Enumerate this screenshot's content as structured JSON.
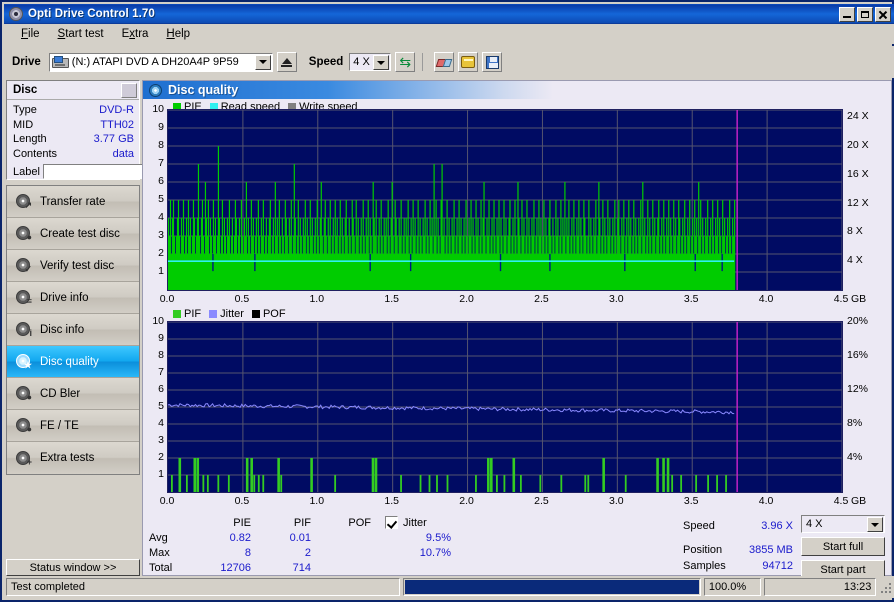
{
  "window": {
    "title": "Opti Drive Control 1.70",
    "icon": "disc-icon",
    "buttons": {
      "minimize": "minimize",
      "maximize": "maximize",
      "close": "close"
    }
  },
  "menu": {
    "items": [
      "File",
      "Start test",
      "Extra",
      "Help"
    ]
  },
  "toolbar": {
    "drive_label": "Drive",
    "drive_value": "(N:)  ATAPI DVD A  DH20A4P 9P59",
    "eject_label": "eject-button",
    "speed_label": "Speed",
    "speed_value": "4 X",
    "icons": [
      "refresh-icon",
      "eraser-icon",
      "bookmark-icon",
      "save-icon"
    ]
  },
  "disc": {
    "header": "Disc",
    "rows": [
      {
        "key": "Type",
        "value": "DVD-R"
      },
      {
        "key": "MID",
        "value": "TTH02"
      },
      {
        "key": "Length",
        "value": "3.77 GB"
      },
      {
        "key": "Contents",
        "value": "data"
      }
    ],
    "label_key": "Label",
    "label_value": ""
  },
  "sidebar": {
    "items": [
      {
        "label": "Transfer rate",
        "active": false
      },
      {
        "label": "Create test disc",
        "active": false
      },
      {
        "label": "Verify test disc",
        "active": false
      },
      {
        "label": "Drive info",
        "active": false
      },
      {
        "label": "Disc info",
        "active": false
      },
      {
        "label": "Disc quality",
        "active": true
      },
      {
        "label": "CD Bler",
        "active": false
      },
      {
        "label": "FE / TE",
        "active": false
      },
      {
        "label": "Extra tests",
        "active": false
      }
    ],
    "status_window": "Status window >>"
  },
  "panel": {
    "title": "Disc quality"
  },
  "stats": {
    "columns": [
      "PIE",
      "PIF",
      "POF"
    ],
    "jitter_label": "Jitter",
    "jitter_checked": true,
    "rows": [
      {
        "label": "Avg",
        "pie": "0.82",
        "pif": "0.01",
        "pof": "",
        "jitter": "9.5%"
      },
      {
        "label": "Max",
        "pie": "8",
        "pif": "2",
        "pof": "",
        "jitter": "10.7%"
      },
      {
        "label": "Total",
        "pie": "12706",
        "pif": "714",
        "pof": "",
        "jitter": ""
      }
    ],
    "speed_key": "Speed",
    "speed_value": "3.96 X",
    "position_key": "Position",
    "position_value": "3855 MB",
    "samples_key": "Samples",
    "samples_value": "94712",
    "speed_select": "4 X",
    "start_full": "Start full",
    "start_part": "Start part"
  },
  "statusbar": {
    "message": "Test completed",
    "progress_text": "100.0%",
    "progress_percent": 100,
    "time": "13:23"
  },
  "colors": {
    "pie": "#00cc00",
    "read_speed": "#2ff0f0",
    "write_speed": "#808080",
    "pif": "#33cc22",
    "jitter": "#8a8aff",
    "pof": "#000000",
    "plot_bg": "#000b63",
    "marker": "#cc22cc",
    "accent": "#1a1acc"
  },
  "chart_data": [
    {
      "type": "bar",
      "title": "Disc quality - PIE",
      "legend": [
        {
          "name": "PIE",
          "color": "#00cc00"
        },
        {
          "name": "Read speed",
          "color": "#2ff0f0"
        },
        {
          "name": "Write speed",
          "color": "#808080"
        }
      ],
      "legend_position": "top-left",
      "xlabel": "GB",
      "ylabel": "PIE",
      "xlim": [
        0,
        4.5
      ],
      "ylim": [
        0,
        10
      ],
      "y2lim": [
        0,
        25
      ],
      "y2label": "X",
      "xticks": [
        "0.0",
        "0.5",
        "1.0",
        "1.5",
        "2.0",
        "2.5",
        "3.0",
        "3.5",
        "4.0",
        "4.5"
      ],
      "yticks": [
        "1",
        "2",
        "3",
        "4",
        "5",
        "6",
        "7",
        "8",
        "9",
        "10"
      ],
      "y2ticks": [
        "4 X",
        "8 X",
        "12 X",
        "16 X",
        "20 X",
        "24 X"
      ],
      "grid": true,
      "data_end_gb": 3.78,
      "marker_gb": 3.8,
      "series": [
        {
          "name": "PIE",
          "type": "bar",
          "color": "#00cc00",
          "baseline": 2,
          "summary": {
            "avg": 0.82,
            "max": 8,
            "total": 12706
          },
          "values": [
            4,
            3,
            5,
            2,
            4,
            5,
            3,
            2,
            3,
            4,
            5,
            3,
            2,
            4,
            3,
            5,
            2,
            3,
            4,
            2,
            5,
            3,
            4,
            2,
            3,
            5,
            4,
            2,
            3,
            4,
            7,
            3,
            2,
            4,
            5,
            3,
            2,
            6,
            4,
            3,
            5,
            2,
            4,
            3,
            2,
            5,
            3,
            4,
            2,
            3,
            8,
            4,
            2,
            3,
            5,
            2,
            4,
            3,
            2,
            4,
            3,
            5,
            2,
            3,
            4,
            2,
            3,
            5,
            4,
            2,
            3,
            4,
            2,
            5,
            3,
            2,
            4,
            3,
            6,
            2,
            4,
            3,
            2,
            5,
            3,
            4,
            2,
            3,
            4,
            2,
            5,
            3,
            2,
            4,
            3,
            5,
            2,
            3,
            4,
            2,
            3,
            4,
            5,
            2,
            3,
            4,
            2,
            6,
            3,
            4,
            2,
            5,
            3,
            2,
            4,
            3,
            2,
            5,
            4,
            3,
            2,
            4,
            3,
            5,
            2,
            3,
            7,
            4,
            2,
            3,
            5,
            2,
            4,
            3,
            2,
            4,
            3,
            5,
            2,
            4,
            3,
            2,
            5,
            3,
            4,
            2,
            3,
            4,
            2,
            5,
            3,
            2,
            4,
            6,
            3,
            2,
            4,
            5,
            3,
            2,
            4,
            3,
            5,
            2,
            3,
            4,
            2,
            5,
            3,
            4,
            2,
            3,
            5,
            2,
            4,
            3,
            2,
            4,
            5,
            3,
            2,
            4,
            3,
            2,
            5,
            4,
            3,
            2,
            5,
            3,
            4,
            2,
            3,
            4,
            2,
            5,
            3,
            2,
            4,
            3,
            5,
            2,
            4,
            3,
            2,
            6,
            4,
            3,
            5,
            2,
            3,
            4,
            2,
            5,
            3,
            2,
            4,
            3,
            4,
            2,
            5,
            3,
            2,
            4,
            6,
            3,
            2,
            5,
            4,
            3,
            2,
            4,
            3,
            5,
            2,
            3,
            4,
            2,
            4,
            3,
            5,
            2,
            3,
            4,
            2,
            5,
            3,
            4,
            2,
            3,
            5,
            2,
            4,
            3,
            2,
            4,
            3,
            5,
            2,
            4,
            3,
            2,
            5,
            3,
            4,
            2,
            7,
            3,
            5,
            2,
            4,
            3,
            2,
            5,
            7,
            3,
            4,
            2,
            3,
            5,
            2,
            4,
            3,
            2,
            4,
            3,
            5,
            2,
            3,
            4,
            2,
            5,
            3,
            4,
            2,
            3,
            4,
            2,
            5,
            3,
            2,
            4,
            3,
            5,
            2,
            4,
            3,
            2,
            5,
            3,
            4,
            2,
            3,
            5,
            2,
            4,
            6,
            3,
            2,
            4,
            3,
            5,
            2,
            3,
            4,
            2,
            5,
            3,
            2,
            4,
            3,
            5,
            2,
            4,
            3,
            2,
            5,
            3,
            4,
            2,
            3,
            4,
            5,
            2,
            3,
            4,
            2,
            5,
            3,
            2,
            6,
            4,
            3,
            2,
            5,
            3,
            4,
            2,
            3,
            5,
            2,
            4,
            3,
            2,
            4,
            3,
            5,
            2,
            3,
            4,
            2,
            5,
            3,
            4,
            2,
            3,
            5,
            2,
            4,
            3,
            2,
            4,
            5,
            3,
            2,
            4,
            3,
            2,
            5,
            3,
            4,
            2,
            3,
            5,
            2,
            4,
            3,
            6,
            2,
            4,
            3,
            5,
            2,
            3,
            4,
            2,
            5,
            3,
            2,
            4,
            3,
            5,
            2,
            4,
            3,
            2,
            5,
            4,
            3,
            2,
            3,
            5,
            2,
            4,
            3,
            2,
            4,
            3,
            5,
            2,
            3,
            6,
            4,
            2,
            3,
            5,
            2,
            4,
            3,
            2,
            5,
            3,
            4,
            2,
            3,
            4,
            2,
            5,
            3,
            2,
            4,
            5,
            3,
            2,
            4,
            3,
            5,
            2,
            3,
            4,
            2,
            5,
            3,
            4,
            2,
            3,
            5,
            2,
            4,
            3,
            2,
            4,
            3,
            5,
            2,
            6,
            3,
            4,
            2,
            3,
            5,
            2,
            4,
            3,
            2,
            5,
            3,
            4,
            2,
            3,
            4,
            5,
            2,
            3,
            4,
            2,
            5,
            3,
            2,
            4,
            3,
            5,
            2,
            4,
            3,
            2,
            5,
            3,
            4,
            2,
            3,
            5,
            4,
            2,
            3,
            4,
            2,
            5,
            3,
            2,
            4,
            3,
            5,
            2,
            3,
            4,
            2,
            5,
            3,
            4,
            2,
            6,
            3,
            5,
            2,
            4,
            3,
            2,
            4,
            3,
            5,
            2,
            3,
            4,
            2,
            5,
            3,
            2,
            4,
            3,
            5,
            2,
            4,
            3,
            2,
            5,
            3,
            4,
            2,
            3,
            4,
            2,
            5,
            3,
            2,
            4,
            3,
            5
          ]
        },
        {
          "name": "Read speed",
          "type": "line",
          "color": "#2ff0f0",
          "axis": "y2",
          "constant_x": 4.0,
          "note": "flat read speed trace at approx 4X"
        }
      ]
    },
    {
      "type": "bar",
      "title": "Disc quality - PIF / Jitter",
      "legend": [
        {
          "name": "PIF",
          "color": "#33cc22"
        },
        {
          "name": "Jitter",
          "color": "#8a8aff"
        },
        {
          "name": "POF",
          "color": "#000000"
        }
      ],
      "legend_position": "top-left",
      "xlabel": "GB",
      "ylabel": "PIF",
      "xlim": [
        0,
        4.5
      ],
      "ylim": [
        0,
        10
      ],
      "y2lim": [
        0,
        20
      ],
      "y2label": "%",
      "xticks": [
        "0.0",
        "0.5",
        "1.0",
        "1.5",
        "2.0",
        "2.5",
        "3.0",
        "3.5",
        "4.0",
        "4.5"
      ],
      "yticks": [
        "1",
        "2",
        "3",
        "4",
        "5",
        "6",
        "7",
        "8",
        "9",
        "10"
      ],
      "y2ticks": [
        "4%",
        "8%",
        "12%",
        "16%",
        "20%"
      ],
      "grid": true,
      "data_end_gb": 3.78,
      "marker_gb": 3.8,
      "series": [
        {
          "name": "PIF",
          "type": "bar",
          "color": "#33cc22",
          "summary": {
            "avg": 0.01,
            "max": 2,
            "total": 714
          },
          "spikes": [
            {
              "x": 0.02,
              "v": 1
            },
            {
              "x": 0.07,
              "v": 2
            },
            {
              "x": 0.12,
              "v": 1
            },
            {
              "x": 0.17,
              "v": 2
            },
            {
              "x": 0.19,
              "v": 2
            },
            {
              "x": 0.23,
              "v": 1
            },
            {
              "x": 0.26,
              "v": 1
            },
            {
              "x": 0.33,
              "v": 1
            },
            {
              "x": 0.4,
              "v": 1
            },
            {
              "x": 0.52,
              "v": 2
            },
            {
              "x": 0.55,
              "v": 2
            },
            {
              "x": 0.57,
              "v": 1
            },
            {
              "x": 0.6,
              "v": 1
            },
            {
              "x": 0.63,
              "v": 1
            },
            {
              "x": 0.73,
              "v": 2
            },
            {
              "x": 0.75,
              "v": 1
            },
            {
              "x": 0.95,
              "v": 2
            },
            {
              "x": 1.11,
              "v": 1
            },
            {
              "x": 1.36,
              "v": 2
            },
            {
              "x": 1.38,
              "v": 2
            },
            {
              "x": 1.55,
              "v": 1
            },
            {
              "x": 1.68,
              "v": 1
            },
            {
              "x": 1.74,
              "v": 1
            },
            {
              "x": 1.79,
              "v": 1
            },
            {
              "x": 1.86,
              "v": 1
            },
            {
              "x": 2.05,
              "v": 1
            },
            {
              "x": 2.13,
              "v": 2
            },
            {
              "x": 2.15,
              "v": 2
            },
            {
              "x": 2.19,
              "v": 1
            },
            {
              "x": 2.24,
              "v": 1
            },
            {
              "x": 2.3,
              "v": 2
            },
            {
              "x": 2.35,
              "v": 1
            },
            {
              "x": 2.48,
              "v": 1
            },
            {
              "x": 2.62,
              "v": 1
            },
            {
              "x": 2.78,
              "v": 1
            },
            {
              "x": 2.8,
              "v": 1
            },
            {
              "x": 2.9,
              "v": 2
            },
            {
              "x": 3.05,
              "v": 1
            },
            {
              "x": 3.26,
              "v": 2
            },
            {
              "x": 3.3,
              "v": 2
            },
            {
              "x": 3.33,
              "v": 2
            },
            {
              "x": 3.36,
              "v": 1
            },
            {
              "x": 3.42,
              "v": 1
            },
            {
              "x": 3.52,
              "v": 1
            },
            {
              "x": 3.6,
              "v": 1
            },
            {
              "x": 3.66,
              "v": 1
            },
            {
              "x": 3.72,
              "v": 1
            }
          ]
        },
        {
          "name": "Jitter",
          "type": "line",
          "color": "#8a8aff",
          "axis": "y2",
          "summary": {
            "avg": "9.5%",
            "max": "10.7%"
          },
          "note": "noisy trace drifting from about 10.2% down to 9.4%"
        }
      ]
    }
  ]
}
